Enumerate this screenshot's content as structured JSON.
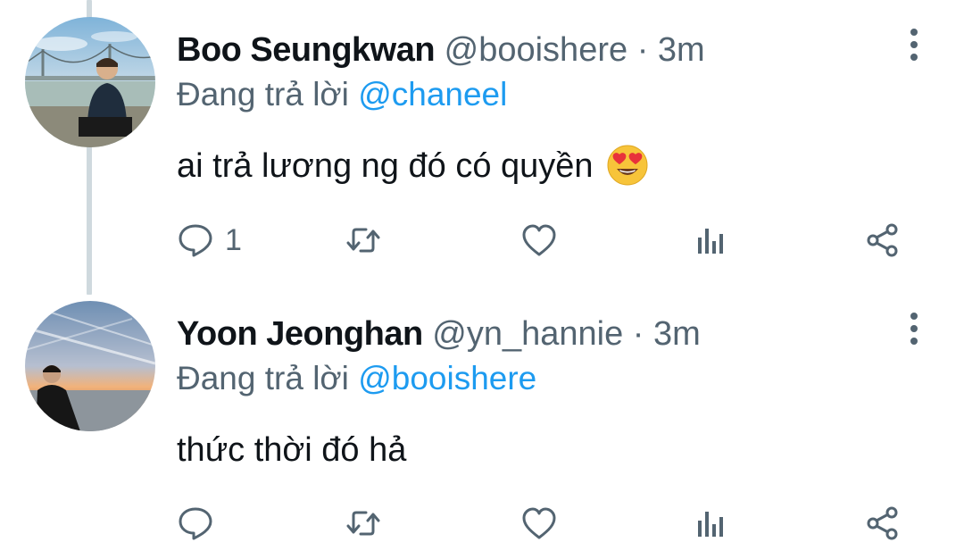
{
  "tweets": [
    {
      "display_name": "Boo Seungkwan",
      "handle": "@booishere",
      "separator": "·",
      "time": "3m",
      "reply_prefix": "Đang trả lời ",
      "reply_to": "@chaneel",
      "text": "ai trả lương ng đó có quyền",
      "emoji": "heart-eyes-emoji",
      "reply_count": "1",
      "icons": [
        "comment-icon",
        "retweet-icon",
        "like-icon",
        "views-icon",
        "share-icon",
        "more-icon"
      ]
    },
    {
      "display_name": "Yoon Jeonghan",
      "handle": "@yn_hannie",
      "separator": "·",
      "time": "3m",
      "reply_prefix": "Đang trả lời ",
      "reply_to": "@booishere",
      "text": "thức thời đó hả",
      "reply_count": "",
      "icons": [
        "comment-icon",
        "retweet-icon",
        "like-icon",
        "views-icon",
        "share-icon",
        "more-icon"
      ]
    }
  ],
  "colors": {
    "text_primary": "#0f1419",
    "text_secondary": "#536471",
    "mention": "#1d9bf0",
    "thread_line": "#cfd9de"
  }
}
